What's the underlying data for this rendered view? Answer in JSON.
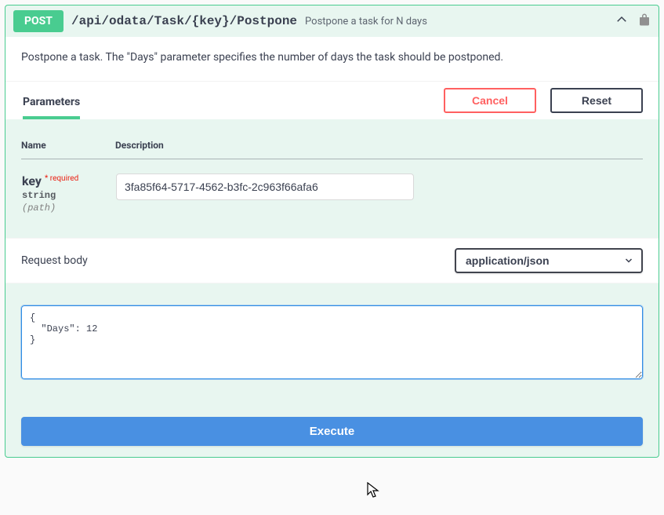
{
  "operation": {
    "method": "POST",
    "path": "/api/odata/Task/{key}/Postpone",
    "summary": "Postpone a task for N days",
    "description": "Postpone a task. The \"Days\" parameter specifies the number of days the task should be postponed."
  },
  "tabs": {
    "parameters": "Parameters",
    "cancel_label": "Cancel",
    "reset_label": "Reset"
  },
  "params_table": {
    "col_name": "Name",
    "col_desc": "Description"
  },
  "params": [
    {
      "name": "key",
      "required_label": "* required",
      "type": "string",
      "in": "(path)",
      "value": "3fa85f64-5717-4562-b3fc-2c963f66afa6"
    }
  ],
  "request_body": {
    "label": "Request body",
    "content_type_selected": "application/json",
    "body_text": "{\n  \"Days\": 12\n}"
  },
  "actions": {
    "execute_label": "Execute"
  },
  "colors": {
    "accent_green": "#49cc90",
    "execute_blue": "#4990e2",
    "danger_red": "#ff6060"
  }
}
